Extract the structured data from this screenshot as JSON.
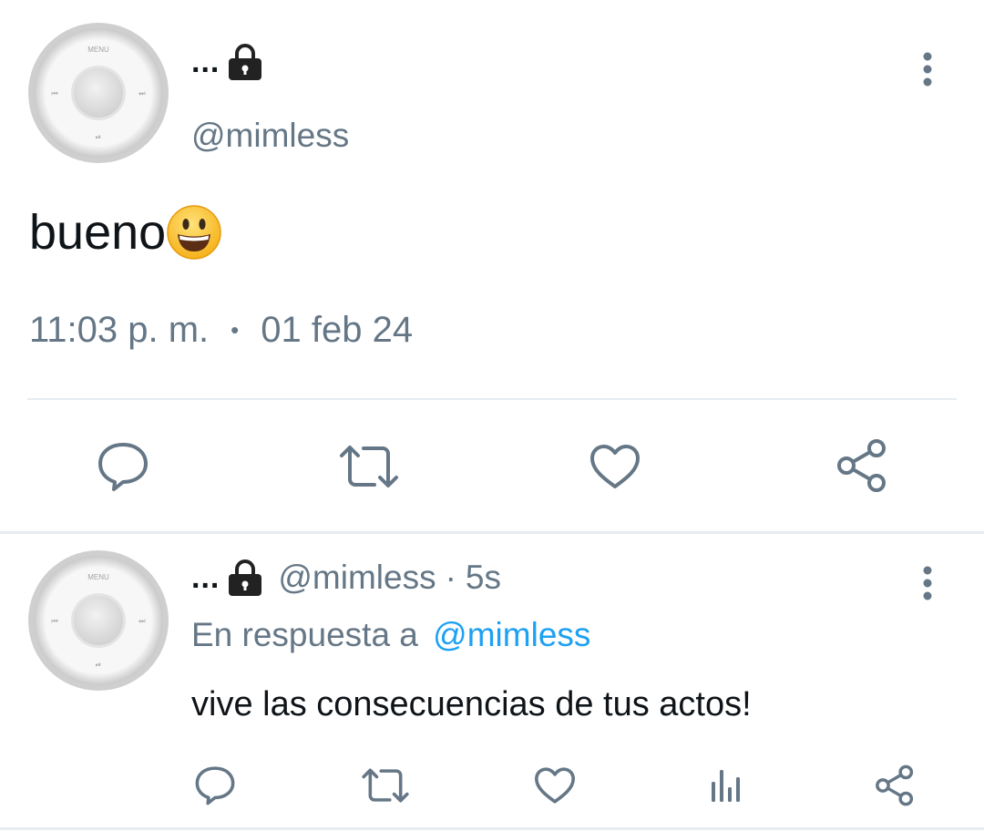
{
  "colors": {
    "text": "#0f1419",
    "secondary": "#657786",
    "link": "#1da1f2",
    "divider": "#e6ecf0",
    "icon": "#657786"
  },
  "main_tweet": {
    "avatar": {
      "icon": "ipod-click-wheel-avatar",
      "menu_label": "MENU"
    },
    "display_name": "...",
    "lock_icon": "lock-icon",
    "handle": "@mimless",
    "text": "bueno",
    "emoji": "smiling-face-emoji",
    "time": "11:03 p. m.",
    "separator": "•",
    "date": "01 feb 24",
    "more_icon": "vertical-dots-icon",
    "actions": [
      "reply-icon",
      "retweet-icon",
      "like-icon",
      "share-icon"
    ]
  },
  "reply_tweet": {
    "avatar": {
      "icon": "ipod-click-wheel-avatar",
      "menu_label": "MENU"
    },
    "display_name": "...",
    "lock_icon": "lock-icon",
    "handle": "@mimless",
    "separator": "·",
    "age": "5s",
    "reply_prefix": "En respuesta a",
    "reply_to": "@mimless",
    "text": "vive las consecuencias de tus actos!",
    "more_icon": "vertical-dots-icon",
    "actions": [
      "reply-icon",
      "retweet-icon",
      "like-icon",
      "analytics-icon",
      "share-icon"
    ]
  }
}
